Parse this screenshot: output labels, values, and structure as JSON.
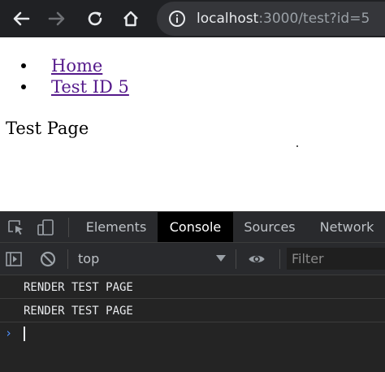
{
  "browser": {
    "url_host": "localhost",
    "url_rest": ":3000/test?id=5",
    "colors": {
      "topbar": "#202124",
      "omnibox": "#35363a"
    }
  },
  "page": {
    "nav": [
      {
        "label": "Home"
      },
      {
        "label": "Test ID 5"
      }
    ],
    "heading": "Test Page",
    "link_color": "#551a8b"
  },
  "devtools": {
    "tabs": [
      {
        "label": "Elements"
      },
      {
        "label": "Console",
        "active": true
      },
      {
        "label": "Sources"
      },
      {
        "label": "Network"
      }
    ],
    "toolbar": {
      "context": "top",
      "filter_placeholder": "Filter"
    },
    "console": {
      "logs": [
        {
          "text": "RENDER TEST PAGE"
        },
        {
          "text": "RENDER TEST PAGE"
        }
      ],
      "prompt": "›"
    },
    "icons": [
      "inspect-element-icon",
      "device-toolbar-icon",
      "sidebar-toggle-icon",
      "clear-console-icon",
      "dropdown-caret-icon",
      "eye-icon"
    ],
    "accent_color": "#4d90fe"
  }
}
